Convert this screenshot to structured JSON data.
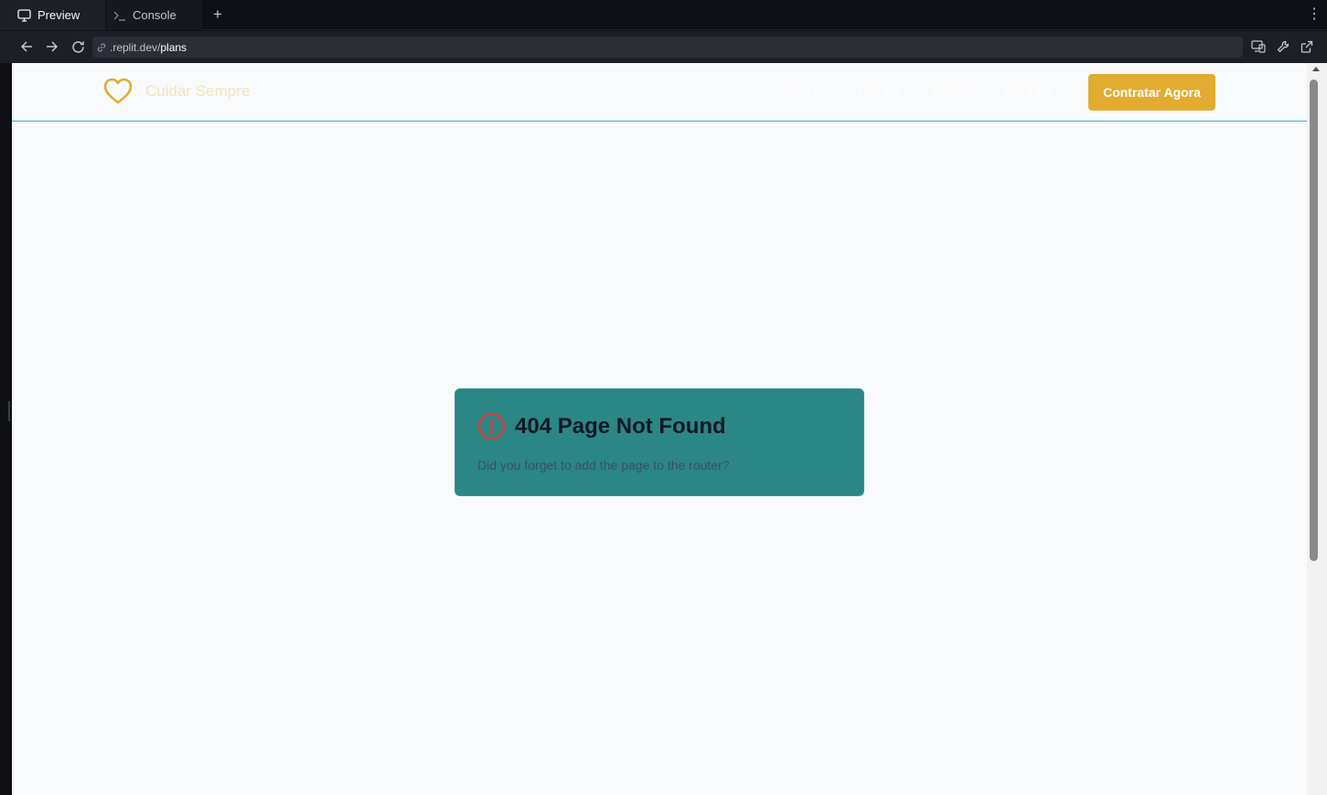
{
  "browser": {
    "tabs": [
      {
        "label": "Preview",
        "icon": "monitor-icon"
      },
      {
        "label": "Console",
        "icon": "terminal-icon"
      }
    ],
    "add_tab_label": "+",
    "more_label": "⋮",
    "url": {
      "host": ".replit.dev/",
      "path": "plans"
    }
  },
  "site": {
    "logo_icon": "heart-icon",
    "brand": "Cuidar Sempre",
    "nav": [
      "Início",
      "Planos",
      "Sobre",
      "Contato"
    ],
    "cta_label": "Contratar Agora",
    "accent_color": "#e2ac30"
  },
  "error_card": {
    "icon": "alert-circle-icon",
    "title": "404 Page Not Found",
    "message": "Did you forget to add the page to the router?"
  }
}
